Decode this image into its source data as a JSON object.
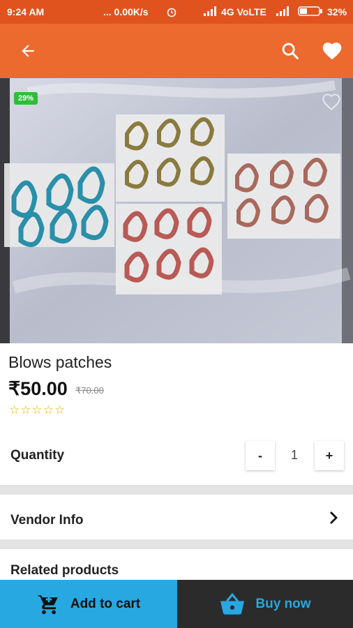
{
  "status_bar": {
    "time": "9:24 AM",
    "network_speed": "... 0.00K/s",
    "network_type": "4G VoLTE",
    "battery": "32%"
  },
  "app_bar": {
    "back_icon": "arrow-left",
    "search_icon": "search",
    "wishlist_icon": "heart"
  },
  "product": {
    "discount_badge": "29%",
    "title": "Blows patches",
    "price": "₹50.00",
    "original_price": "₹70.00",
    "rating": 0,
    "rating_stars": "☆☆☆☆☆"
  },
  "quantity": {
    "label": "Quantity",
    "decrement_label": "-",
    "value": "1",
    "increment_label": "+"
  },
  "vendor_info": {
    "label": "Vendor Info",
    "chevron_icon": "chevron-right"
  },
  "related": {
    "label": "Related products"
  },
  "actions": {
    "add_to_cart": "Add to cart",
    "buy_now": "Buy now"
  },
  "colors": {
    "brand_orange": "#ec6a2e",
    "status_orange": "#e0531f",
    "cart_blue": "#27a8e0",
    "buy_dark": "#2b2b2b",
    "badge_green": "#2ebd3a",
    "star_gold": "#e8b008"
  }
}
